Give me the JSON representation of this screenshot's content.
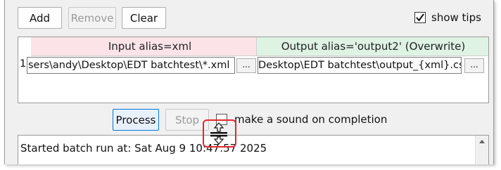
{
  "toolbar": {
    "add_label": "Add",
    "remove_label": "Remove",
    "clear_label": "Clear",
    "show_tips_label": "show tips",
    "show_tips_checked": true
  },
  "table": {
    "input_header": "Input alias=xml",
    "output_header": "Output alias='output2' (Overwrite)",
    "header_colors": {
      "input": "#fbe3e8",
      "output": "#def3e4"
    },
    "rows": [
      {
        "index": "1",
        "input_path": "sers\\andy\\Desktop\\EDT batchtest\\*.xml",
        "input_browse": "...",
        "output_path": "Desktop\\EDT batchtest\\output_{xml}.csv",
        "output_browse": "..."
      }
    ]
  },
  "actions": {
    "process_label": "Process",
    "stop_label": "Stop",
    "sound_label": "make a sound on completion",
    "sound_checked": false
  },
  "log": {
    "text": "Started batch run at: Sat Aug 9 10:47:57 2025"
  },
  "colors": {
    "focus": "#0078d7",
    "highlight": "#e0282f"
  }
}
